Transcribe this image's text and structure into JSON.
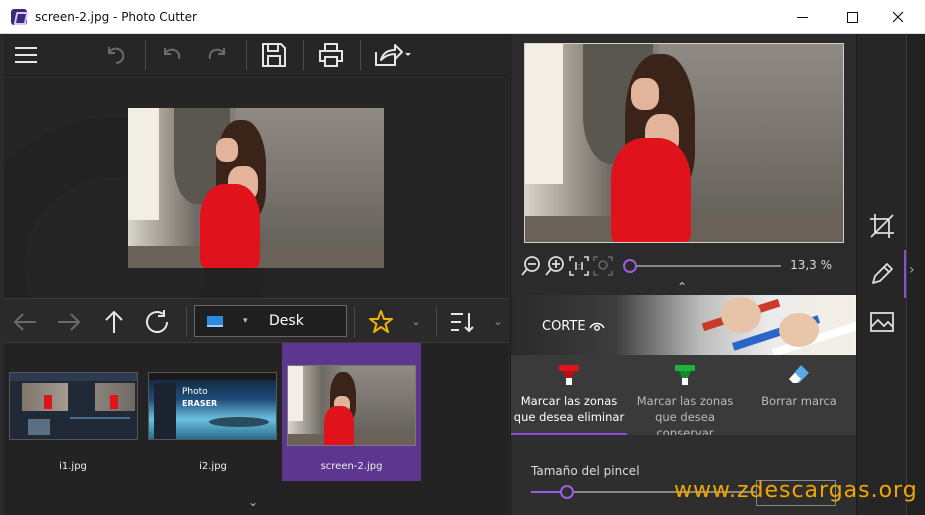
{
  "window": {
    "title": "screen-2.jpg - Photo Cutter"
  },
  "navigation": {
    "location_label": "Desk"
  },
  "thumbnails": [
    {
      "label": "i1.jpg",
      "selected": false
    },
    {
      "label": "i2.jpg",
      "selected": false
    },
    {
      "label": "screen-2.jpg",
      "selected": true
    }
  ],
  "preview": {
    "zoom_value": "13,3 %"
  },
  "banner": {
    "label": "CORTE"
  },
  "tools": [
    {
      "label": "Marcar las zonas que desea eliminar",
      "active": true,
      "icon": "red-marker-icon"
    },
    {
      "label": "Marcar las zonas que desea conservar",
      "active": false,
      "icon": "green-marker-icon"
    },
    {
      "label": "Borrar marca",
      "active": false,
      "icon": "eraser-icon"
    }
  ],
  "brush": {
    "label": "Tamaño del pincel",
    "size_fraction": 0.15
  },
  "thumb_text": {
    "photo": "Photo",
    "eraser": "ERASER"
  },
  "watermark": "www.zdescargas.org",
  "colors": {
    "accent": "#8a4fd6",
    "selection": "#5d3690",
    "dress": "#e0131d",
    "watermark": "#f0a500"
  }
}
